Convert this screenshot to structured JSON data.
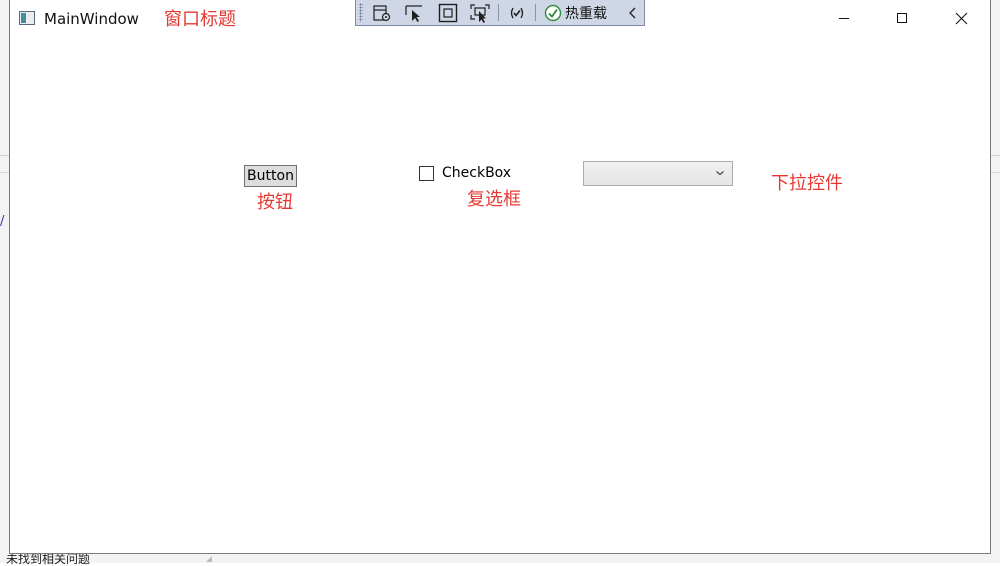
{
  "window": {
    "title": "MainWindow",
    "caption_buttons": [
      "minimize",
      "maximize",
      "close"
    ]
  },
  "toolbar": {
    "hot_reload_label": "热重载",
    "icons": [
      "select-visual-tree-icon",
      "select-element-icon",
      "display-layout-adorners-icon",
      "track-focus-icon",
      "xaml-binding-icon",
      "hot-reload-ok-icon",
      "collapse-toolbar-icon"
    ]
  },
  "controls": {
    "button_label": "Button",
    "checkbox_label": "CheckBox",
    "checkbox_checked": false,
    "combobox_value": ""
  },
  "annotations": {
    "window_title": "窗口标题",
    "button": "按钮",
    "checkbox": "复选框",
    "combobox": "下拉控件"
  },
  "background": {
    "status_text": "未找到相关问题",
    "slash": "/"
  },
  "colors": {
    "annotation": "#e53935",
    "toolbar_bg": "#cfd6e5",
    "button_bg": "#dddddd"
  }
}
